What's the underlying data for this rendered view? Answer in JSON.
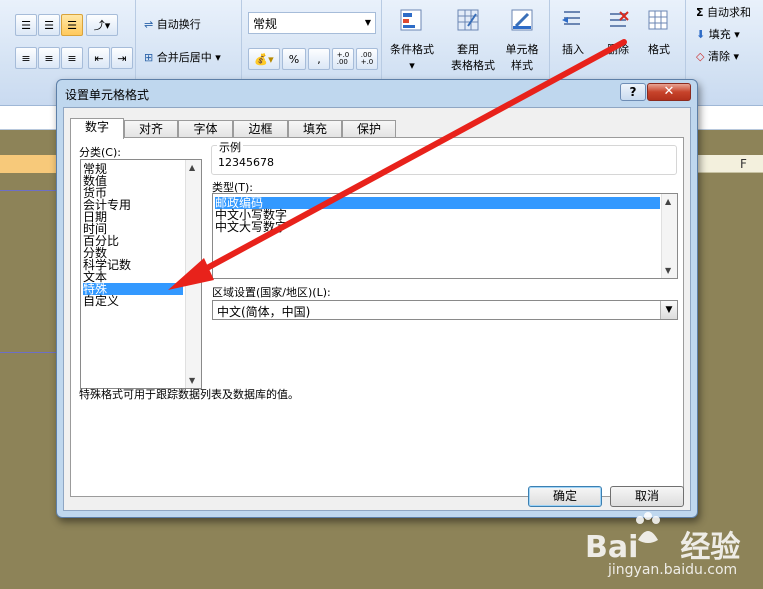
{
  "ribbon": {
    "wrap_text": "自动换行",
    "merge_center": "合并后居中",
    "number_format_value": "常规",
    "percent_symbol": "%",
    "comma_symbol": ",",
    "inc_decimal": "+.0\n.00",
    "dec_decimal": ".00\n+.0",
    "conditional_format": "条件格式",
    "table_format_line1": "套用",
    "table_format_line2": "表格格式",
    "cell_style_line1": "单元格",
    "cell_style_line2": "样式",
    "insert": "插入",
    "delete": "删除",
    "format": "格式",
    "autosum": "自动求和",
    "fill": "填充",
    "clear": "清除"
  },
  "sheet": {
    "col_f": "F"
  },
  "dialog": {
    "title": "设置单元格格式",
    "help": "?",
    "close": "✕",
    "tabs": [
      "数字",
      "对齐",
      "字体",
      "边框",
      "填充",
      "保护"
    ],
    "category_label": "分类(C):",
    "categories": [
      "常规",
      "数值",
      "货币",
      "会计专用",
      "日期",
      "时间",
      "百分比",
      "分数",
      "科学记数",
      "文本",
      "特殊",
      "自定义"
    ],
    "selected_category": "特殊",
    "sample_label": "示例",
    "sample_value": "12345678",
    "type_label": "类型(T):",
    "types": [
      "邮政编码",
      "中文小写数字",
      "中文大写数字"
    ],
    "selected_type": "邮政编码",
    "locale_label": "区域设置(国家/地区)(L):",
    "locale_value": "中文(简体，中国)",
    "description": "特殊格式可用于跟踪数据列表及数据库的值。",
    "ok": "确定",
    "cancel": "取消"
  },
  "watermark": {
    "brand": "Bai",
    "brand_cn": "经验",
    "url": "jingyan.baidu.com"
  },
  "colors": {
    "arrow": "#e8221b",
    "selection": "#3399ff",
    "sheet_bg": "#8d8358"
  }
}
